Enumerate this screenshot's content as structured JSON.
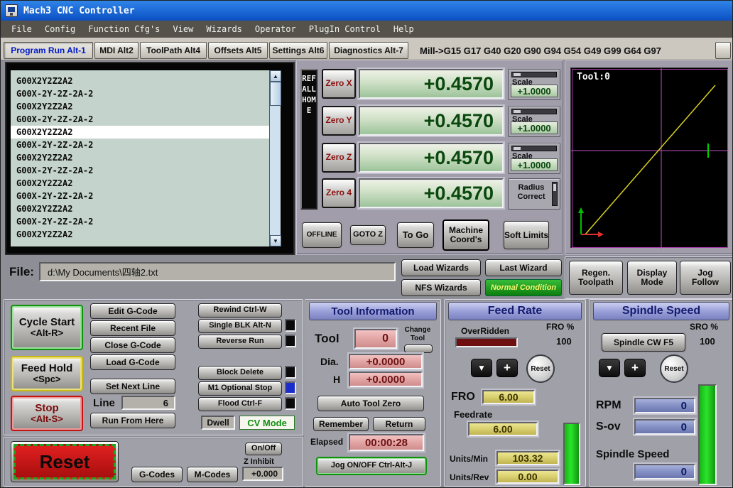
{
  "window": {
    "title": "Mach3 CNC Controller"
  },
  "menu": {
    "items": [
      "File",
      "Config",
      "Function Cfg's",
      "View",
      "Wizards",
      "Operator",
      "PlugIn Control",
      "Help"
    ]
  },
  "tabs": {
    "items": [
      {
        "label": "Program Run Alt-1"
      },
      {
        "label": "MDI Alt2"
      },
      {
        "label": "ToolPath Alt4"
      },
      {
        "label": "Offsets Alt5"
      },
      {
        "label": "Settings Alt6"
      },
      {
        "label": "Diagnostics Alt-7"
      }
    ],
    "modes_text": "Mill->G15  G17 G40 G20 G90 G94 G54 G49 G99 G64 G97"
  },
  "icons": {
    "scroll_up": "▲",
    "scroll_down": "▼",
    "decrease": "▼",
    "increase": "+"
  },
  "gcode": {
    "lines": [
      "G00X2Y2Z2A2",
      "G00X-2Y-2Z-2A-2",
      "G00X2Y2Z2A2",
      "G00X-2Y-2Z-2A-2",
      "G00X2Y2Z2A2",
      "G00X-2Y-2Z-2A-2",
      "G00X2Y2Z2A2",
      "G00X-2Y-2Z-2A-2",
      "G00X2Y2Z2A2",
      "G00X-2Y-2Z-2A-2",
      "G00X2Y2Z2A2",
      "G00X-2Y-2Z-2A-2",
      "G00X2Y2Z2A2"
    ],
    "highlight_index": 4
  },
  "axes": {
    "ref_all_home": "REF ALL HOME",
    "rows": [
      {
        "zero": "Zero X",
        "value": "+0.4570"
      },
      {
        "zero": "Zero Y",
        "value": "+0.4570"
      },
      {
        "zero": "Zero Z",
        "value": "+0.4570"
      },
      {
        "zero": "Zero 4",
        "value": "+0.4570"
      }
    ],
    "scale_label": "Scale",
    "scale_values": [
      "+1.0000",
      "+1.0000",
      "+1.0000"
    ],
    "radius_label": "Radius Correct",
    "buttons": {
      "offline": "OFFLINE",
      "goto_z": "GOTO Z",
      "to_go": "To Go",
      "machine_coords": "Machine Coord's",
      "soft_limits": "Soft Limits"
    }
  },
  "toolpath": {
    "tool_label": "Tool:0"
  },
  "file_bar": {
    "label": "File:",
    "path": "d:\\My Documents\\四轴2.txt",
    "load_wizards": "Load Wizards",
    "last_wizard": "Last Wizard",
    "nfs_wizards": "NFS Wizards",
    "condition": "Normal Condition",
    "regen_toolpath": "Regen. Toolpath",
    "display_mode": "Display Mode",
    "jog_follow": "Jog Follow"
  },
  "run_controls": {
    "cycle_start": "Cycle Start",
    "cycle_start_key": "<Alt-R>",
    "feed_hold": "Feed Hold",
    "feed_hold_key": "<Spc>",
    "stop": "Stop",
    "stop_key": "<Alt-S>",
    "edit_gcode": "Edit G-Code",
    "recent_file": "Recent File",
    "close_gcode": "Close G-Code",
    "load_gcode": "Load G-Code",
    "set_next_line": "Set Next Line",
    "line_label": "Line",
    "line_value": "6",
    "run_from_here": "Run From Here",
    "rewind": "Rewind Ctrl-W",
    "single_blk": "Single BLK Alt-N",
    "reverse_run": "Reverse Run",
    "block_delete": "Block Delete",
    "m1_optional_stop": "M1 Optional Stop",
    "flood": "Flood Ctrl-F",
    "dwell": "Dwell",
    "cv_mode": "CV Mode"
  },
  "reset_area": {
    "reset": "Reset",
    "gcodes": "G-Codes",
    "mcodes": "M-Codes",
    "onoff": "On/Off",
    "z_inhibit": "Z Inhibit",
    "z_inhibit_value": "+0.000"
  },
  "tool_info": {
    "title": "Tool Information",
    "tool_label": "Tool",
    "tool_value": "0",
    "change_tool": "Change Tool",
    "dia_label": "Dia.",
    "dia_value": "+0.0000",
    "h_label": "H",
    "h_value": "+0.0000",
    "auto_tool_zero": "Auto Tool Zero",
    "remember": "Remember",
    "return": "Return",
    "elapsed_label": "Elapsed",
    "elapsed_value": "00:00:28",
    "jog_onoff": "Jog ON/OFF Ctrl-Alt-J"
  },
  "feed_rate": {
    "title": "Feed Rate",
    "overridden": "OverRidden",
    "fro_pct_label": "FRO %",
    "fro_pct_value": "100",
    "reset": "Reset",
    "fro_label": "FRO",
    "fro_value": "6.00",
    "feedrate_label": "Feedrate",
    "feedrate_value": "6.00",
    "units_min_label": "Units/Min",
    "units_min_value": "103.32",
    "units_rev_label": "Units/Rev",
    "units_rev_value": "0.00"
  },
  "spindle": {
    "title": "Spindle Speed",
    "cw_button": "Spindle CW F5",
    "sro_pct_label": "SRO %",
    "sro_pct_value": "100",
    "reset": "Reset",
    "rpm_label": "RPM",
    "rpm_value": "0",
    "sov_label": "S-ov",
    "sov_value": "0",
    "speed_label": "Spindle Speed",
    "speed_value": "0"
  }
}
